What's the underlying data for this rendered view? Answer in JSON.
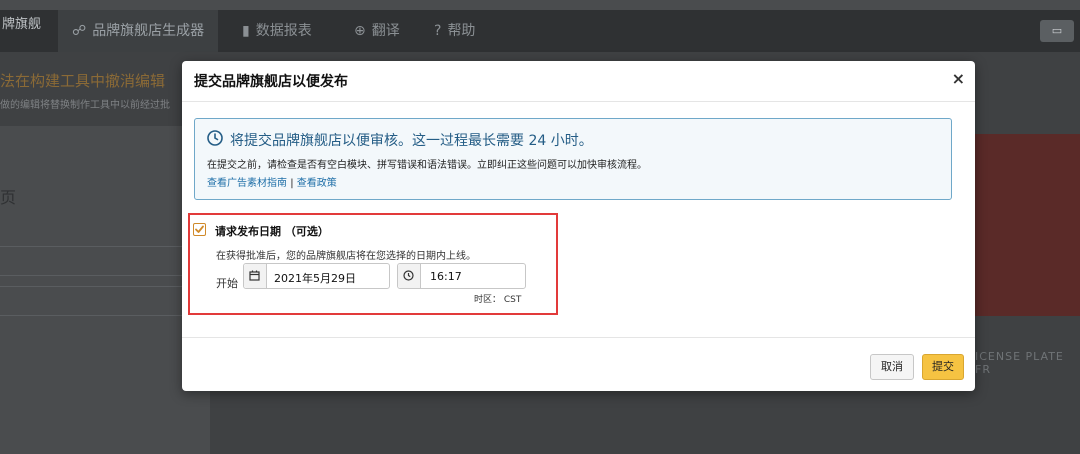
{
  "background": {
    "brand": "牌旗舰",
    "nav_tabs": [
      {
        "label": "品牌旗舰店生成器",
        "icon": "sitemap-icon"
      },
      {
        "label": "数据报表",
        "icon": "bar-chart-icon"
      },
      {
        "label": "翻译",
        "icon": "globe-icon"
      },
      {
        "label": "帮助",
        "icon": "help-icon"
      }
    ],
    "warning_title": "法在构建工具中撤消编辑",
    "warning_sub": "做的编辑将替换制作工具中以前经过批",
    "section_label": "页",
    "right_banner_text": "ICENSE PLATE FR"
  },
  "modal": {
    "title": "提交品牌旗舰店以便发布",
    "close": "×",
    "info": {
      "headline": "将提交品牌旗舰店以便审核。这一过程最长需要 24 小时。",
      "body": "在提交之前，请检查是否有空白模块、拼写错误和语法错误。立即纠正这些问题可以加快审核流程。",
      "link1": "查看广告素材指南",
      "separator": "|",
      "link2": "查看政策"
    },
    "request": {
      "checkbox_label": "请求发布日期 （可选）",
      "description": "在获得批准后，您的品牌旗舰店将在您选择的日期内上线。",
      "start_label": "开始",
      "date_value": "2021年5月29日",
      "time_value": "16:17",
      "timezone": "时区： CST"
    },
    "footer": {
      "cancel": "取消",
      "submit": "提交"
    }
  },
  "colors": {
    "accent": "#f6c342",
    "info_border": "#6fa8c9",
    "highlight": "#e23a3a",
    "link": "#1f6fa8"
  }
}
